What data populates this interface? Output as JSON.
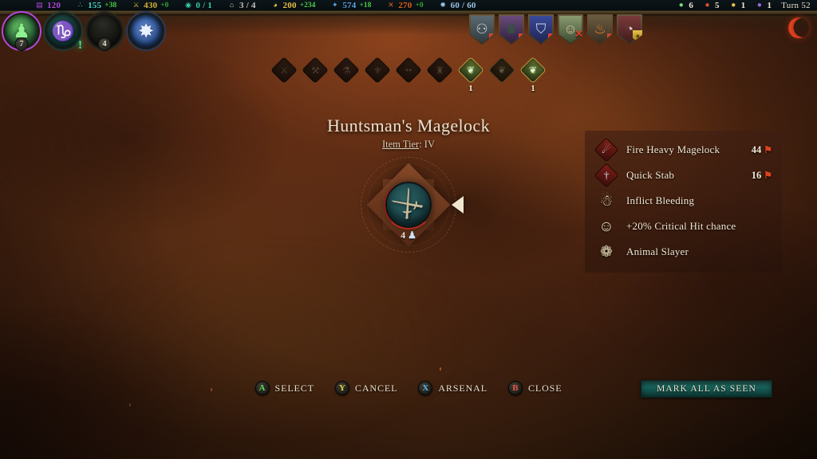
{
  "topbar": {
    "resources": [
      {
        "name": "mana",
        "icon": "▤",
        "icon_color": "#b04ad8",
        "value": "120",
        "delta": ""
      },
      {
        "name": "research",
        "icon": "∴",
        "icon_color": "#48d8c8",
        "value": "155",
        "delta": "+38"
      },
      {
        "name": "draft",
        "icon": "⚔",
        "icon_color": "#d8b83a",
        "value": "430",
        "delta": "+0"
      },
      {
        "name": "imperium",
        "icon": "◉",
        "icon_color": "#3ad0a8",
        "value": "0 / 1",
        "delta": ""
      },
      {
        "name": "cities",
        "icon": "⌂",
        "icon_color": "#c8c8c0",
        "value": "3 / 4",
        "delta": ""
      },
      {
        "name": "gold",
        "icon": "◕",
        "icon_color": "#e8c24a",
        "value": "200",
        "delta": "+234"
      },
      {
        "name": "knowledge",
        "icon": "✦",
        "icon_color": "#5ba6e8",
        "value": "574",
        "delta": "+18"
      },
      {
        "name": "production",
        "icon": "✕",
        "icon_color": "#e0601c",
        "value": "270",
        "delta": "+0"
      },
      {
        "name": "population",
        "icon": "✹",
        "icon_color": "#9ac4e8",
        "value": "60 / 60",
        "delta": ""
      }
    ],
    "right_counters": [
      {
        "name": "order-affinity",
        "icon": "●",
        "icon_color": "#7ad87a",
        "value": "6"
      },
      {
        "name": "chaos-affinity",
        "icon": "●",
        "icon_color": "#e0502a",
        "value": "5"
      },
      {
        "name": "nature-affinity",
        "icon": "●",
        "icon_color": "#e8c24a",
        "value": "1"
      },
      {
        "name": "astral-affinity",
        "icon": "●",
        "icon_color": "#9a6ae0",
        "value": "1"
      }
    ],
    "turn_label": "Turn 52"
  },
  "portraits": [
    {
      "name": "shadow-hero-portrait",
      "count": "7",
      "ring_color": "#b24ad8",
      "bg": "radial-gradient(circle at 45% 40%, #6fd86f, #1e4a2a 60%, #10240f 100%)",
      "glyph": "♟",
      "glyph_color": "#8ef08e",
      "alert": ""
    },
    {
      "name": "ritual-portrait",
      "count": "",
      "ring_color": "#1c3a36",
      "bg": "radial-gradient(circle at 45% 35%, #2e6a62, #113331 60%, #07191a 100%)",
      "glyph": "♑",
      "glyph_color": "#4fe8c0",
      "alert": "!"
    },
    {
      "name": "empty-slot-portrait",
      "count": "4",
      "ring_color": "#2a2a20",
      "bg": "radial-gradient(circle at 45% 30%, #2a2a26, #141410 60%, #060604 100%)",
      "glyph": "",
      "glyph_color": "#000000",
      "alert": ""
    },
    {
      "name": "astral-event-portrait",
      "count": "",
      "ring_color": "#2a3a56",
      "bg": "radial-gradient(circle at 48% 45%, #dfe8ff 0%, #5a86d8 22%, #1b3560 60%, #0a1730 100%)",
      "glyph": "✸",
      "glyph_color": "#e8f0ff",
      "alert": ""
    }
  ],
  "units": [
    {
      "name": "unit-shield-1",
      "glyph": "⚇",
      "glyph_color": "#c8d4d8",
      "bg": "linear-gradient(180deg,#5a6a70,#2e3a40)",
      "marker": "flag"
    },
    {
      "name": "unit-shield-2",
      "glyph": "♛",
      "glyph_color": "#2e5a3a",
      "bg": "linear-gradient(180deg,#6a4a7a,#2e2040)",
      "marker": "flag"
    },
    {
      "name": "unit-shield-3",
      "glyph": "⛉",
      "glyph_color": "#cdd6e8",
      "bg": "linear-gradient(180deg,#3a4a9a,#1e2450)",
      "marker": "flag"
    },
    {
      "name": "unit-shield-4",
      "glyph": "☺",
      "glyph_color": "#e0c4a0",
      "bg": "linear-gradient(180deg,#8a9a70,#3a4a30)",
      "marker": "x"
    },
    {
      "name": "unit-shield-5",
      "glyph": "♨",
      "glyph_color": "#e8802a",
      "bg": "linear-gradient(180deg,#6a5a40,#3a3020)",
      "marker": "flag"
    },
    {
      "name": "unit-shield-6",
      "glyph": "◔",
      "glyph_color": "#d8d0c0",
      "bg": "linear-gradient(180deg,#7a3a3a,#401c1c)",
      "marker": "gold"
    }
  ],
  "pips": [
    {
      "name": "item-pip-1",
      "state": "dim",
      "glyph": "⚔",
      "count": ""
    },
    {
      "name": "item-pip-2",
      "state": "dim",
      "glyph": "⚒",
      "count": ""
    },
    {
      "name": "item-pip-3",
      "state": "dim",
      "glyph": "⚗",
      "count": ""
    },
    {
      "name": "item-pip-4",
      "state": "dim",
      "glyph": "⚜",
      "count": ""
    },
    {
      "name": "item-pip-5",
      "state": "dim",
      "glyph": "••",
      "count": ""
    },
    {
      "name": "item-pip-6",
      "state": "dim",
      "glyph": "♜",
      "count": ""
    },
    {
      "name": "item-pip-7",
      "state": "lit",
      "glyph": "❦",
      "count": "1"
    },
    {
      "name": "item-pip-8",
      "state": "semi",
      "glyph": "❦",
      "count": ""
    },
    {
      "name": "item-pip-9",
      "state": "lit",
      "glyph": "❦",
      "count": "1"
    }
  ],
  "item": {
    "title": "Huntsman's Magelock",
    "tier_label": "Item Tier",
    "tier_value": "IV",
    "glyph": "⚔",
    "count": "4",
    "count_icon": "♟"
  },
  "abilities": [
    {
      "name": "ability-fire-heavy-magelock",
      "icon_style": "diamond",
      "glyph": "☄",
      "glyph_color": "#f0e8e0",
      "label": "Fire Heavy Magelock",
      "damage": "44",
      "damage_icon": "⚑"
    },
    {
      "name": "ability-quick-stab",
      "icon_style": "diamond",
      "glyph": "†",
      "glyph_color": "#dce4ee",
      "label": "Quick Stab",
      "damage": "16",
      "damage_icon": "⚑"
    },
    {
      "name": "ability-inflict-bleeding",
      "icon_style": "plain",
      "glyph": "☃",
      "glyph_color": "#e8dcb8",
      "label": "Inflict Bleeding",
      "damage": "",
      "damage_icon": ""
    },
    {
      "name": "ability-critical-hit-chance",
      "icon_style": "plain",
      "glyph": "☺",
      "glyph_color": "#e8dcb8",
      "label": "+20% Critical Hit chance",
      "damage": "",
      "damage_icon": ""
    },
    {
      "name": "ability-animal-slayer",
      "icon_style": "plain",
      "glyph": "❁",
      "glyph_color": "#e8dcb8",
      "label": "Animal Slayer",
      "damage": "",
      "damage_icon": ""
    }
  ],
  "buttons": [
    {
      "name": "select-button",
      "key": "A",
      "key_class": "key-a",
      "label": "Select"
    },
    {
      "name": "cancel-button",
      "key": "Y",
      "key_class": "key-y",
      "label": "Cancel"
    },
    {
      "name": "arsenal-button",
      "key": "X",
      "key_class": "key-x",
      "label": "Arsenal"
    },
    {
      "name": "close-button",
      "key": "B",
      "key_class": "key-b",
      "label": "Close"
    }
  ],
  "mark_all_as_seen": "Mark all as seen"
}
